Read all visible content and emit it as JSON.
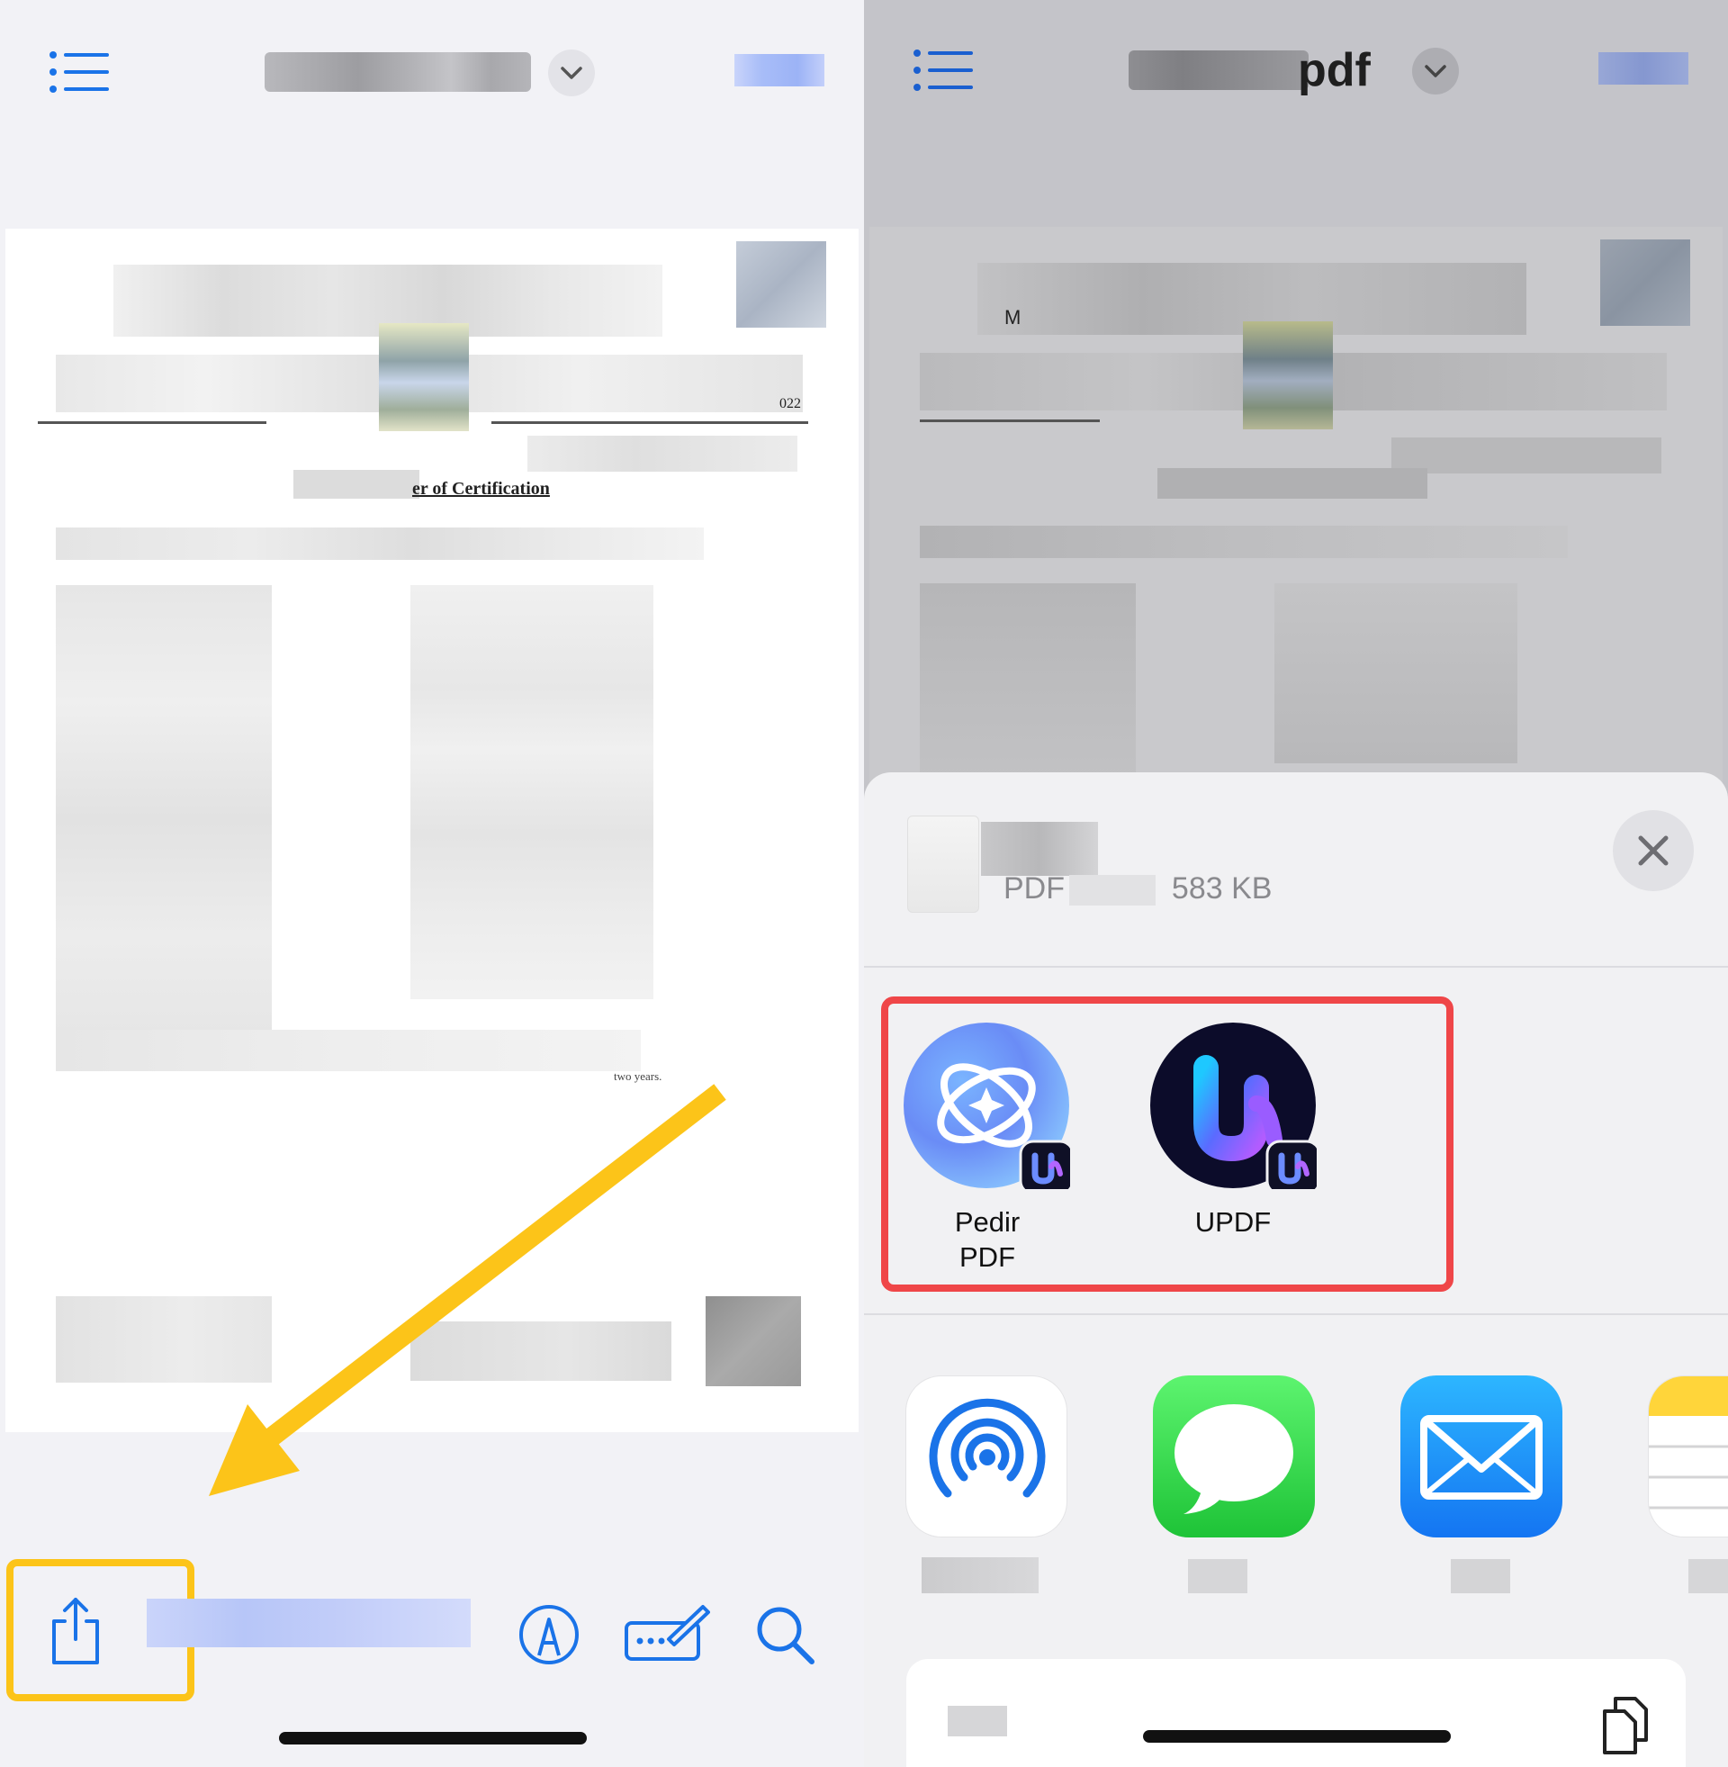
{
  "left": {
    "header": {
      "menu_icon": "list-icon",
      "chevron_icon": "chevron-down-icon"
    },
    "document": {
      "certificate_heading": "er of Certification",
      "year_fragment": "022",
      "footer_fragment": "two years."
    },
    "toolbar": {
      "share_icon": "share-icon",
      "markup_icon": "markup-pen-icon",
      "signature_icon": "signature-icon",
      "search_icon": "search-icon"
    },
    "annotation": {
      "arrow_color": "#fcc419",
      "box_color": "#fcc419"
    }
  },
  "right": {
    "header": {
      "title_fragment": "pdf",
      "menu_icon": "list-icon",
      "chevron_icon": "chevron-down-icon"
    },
    "document": {
      "fragment_m": "M"
    },
    "share_sheet": {
      "file_type": "PDF",
      "file_size": "583 KB",
      "close_icon": "close-icon",
      "highlight_color": "#ef4648",
      "apps": [
        {
          "label_line1": "Pedir",
          "label_line2": "PDF",
          "icon": "pedir-pdf-app-icon"
        },
        {
          "label_line1": "UPDF",
          "label_line2": "",
          "icon": "updf-app-icon"
        }
      ],
      "share_targets": [
        {
          "icon": "airdrop-icon"
        },
        {
          "icon": "messages-icon"
        },
        {
          "icon": "mail-icon"
        },
        {
          "icon": "notes-icon"
        }
      ],
      "copy_icon": "copy-icon"
    }
  }
}
